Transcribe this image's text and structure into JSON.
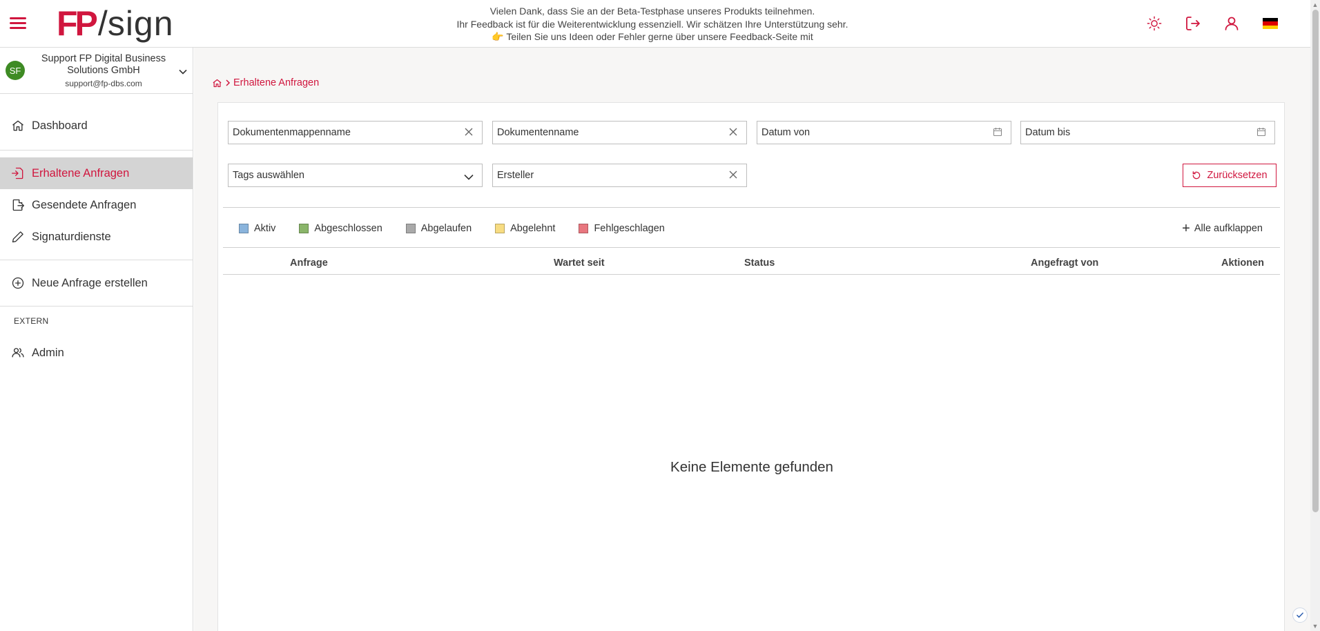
{
  "header": {
    "brand": {
      "fp": "FP",
      "slash": "/",
      "sign": "sign"
    },
    "beta_lines": [
      "Vielen Dank, dass Sie an der Beta-Testphase unseres Produkts teilnehmen.",
      "Ihr Feedback ist für die Weiterentwicklung essenziell. Wir schätzen Ihre Unterstützung sehr.",
      "👉 Teilen Sie uns Ideen oder Fehler gerne über unsere Feedback-Seite mit"
    ],
    "icons": [
      "sun-icon",
      "logout-icon",
      "user-icon",
      "flag-de-icon"
    ]
  },
  "account": {
    "initials": "SF",
    "name": "Support FP Digital Business Solutions GmbH",
    "email": "support@fp-dbs.com"
  },
  "sidebar": {
    "items": [
      {
        "label": "Dashboard",
        "icon": "home-icon",
        "active": false
      },
      {
        "label": "Erhaltene Anfragen",
        "icon": "inbox-in-icon",
        "active": true
      },
      {
        "label": "Gesendete Anfragen",
        "icon": "send-file-icon",
        "active": false
      },
      {
        "label": "Signaturdienste",
        "icon": "pen-icon",
        "active": false
      },
      {
        "label": "Neue Anfrage erstellen",
        "icon": "plus-circle-icon",
        "active": false
      }
    ],
    "section_extern": "EXTERN",
    "admin_label": "Admin"
  },
  "breadcrumb": {
    "current": "Erhaltene Anfragen"
  },
  "filters": {
    "folder_name": "Dokumentenmappenname",
    "document_name": "Dokumentenname",
    "date_from": "Datum von",
    "date_to": "Datum bis",
    "tags": "Tags auswählen",
    "creator": "Ersteller",
    "reset_label": "Zurücksetzen"
  },
  "legend": [
    {
      "label": "Aktiv",
      "color": "#8ab4dc"
    },
    {
      "label": "Abgeschlossen",
      "color": "#8ab56a"
    },
    {
      "label": "Abgelaufen",
      "color": "#a9a9a9"
    },
    {
      "label": "Abgelehnt",
      "color": "#f7dc82"
    },
    {
      "label": "Fehlgeschlagen",
      "color": "#e8777f"
    }
  ],
  "expand_label": "Alle aufklappen",
  "table": {
    "columns": [
      "Anfrage",
      "Wartet seit",
      "Status",
      "Angefragt von",
      "Aktionen"
    ],
    "empty": "Keine Elemente gefunden"
  },
  "colors": {
    "accent": "#d0163e",
    "active_bg": "#d4d4d4",
    "avatar": "#3e8b24"
  }
}
